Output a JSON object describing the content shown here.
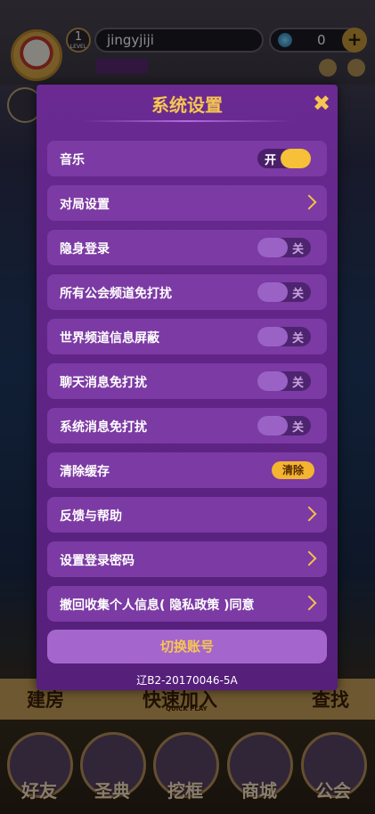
{
  "background": {
    "username": "jingyjiji",
    "level": "1",
    "level_caption": "LEVEL",
    "gems": "0",
    "bottom_buttons": [
      "建房",
      "快速加入",
      "查找"
    ],
    "quick_play_caption": "QUICK PLAY",
    "nav": [
      "好友",
      "圣典",
      "挖框",
      "商城",
      "公会"
    ]
  },
  "modal": {
    "title": "系统设置",
    "close_icon": "close-icon",
    "rows": [
      {
        "label": "音乐",
        "control": "toggle",
        "state": "on",
        "state_label": "开"
      },
      {
        "label": "对局设置",
        "control": "chevron"
      },
      {
        "label": "隐身登录",
        "control": "toggle",
        "state": "off",
        "state_label": "关"
      },
      {
        "label": "所有公会频道免打扰",
        "control": "toggle",
        "state": "off",
        "state_label": "关"
      },
      {
        "label": "世界频道信息屏蔽",
        "control": "toggle",
        "state": "off",
        "state_label": "关"
      },
      {
        "label": "聊天消息免打扰",
        "control": "toggle",
        "state": "off",
        "state_label": "关"
      },
      {
        "label": "系统消息免打扰",
        "control": "toggle",
        "state": "off",
        "state_label": "关"
      },
      {
        "label": "清除缓存",
        "control": "button",
        "button_label": "清除"
      },
      {
        "label": "反馈与帮助",
        "control": "chevron"
      },
      {
        "label": "设置登录密码",
        "control": "chevron"
      },
      {
        "label": "撤回收集个人信息( 隐私政策 )同意",
        "control": "chevron"
      }
    ],
    "switch_account": "切换账号",
    "license": "辽B2-20170046-5A"
  },
  "colors": {
    "accent": "#f7c650",
    "panel": "#6a2a92",
    "row": "#7c3aa4"
  }
}
